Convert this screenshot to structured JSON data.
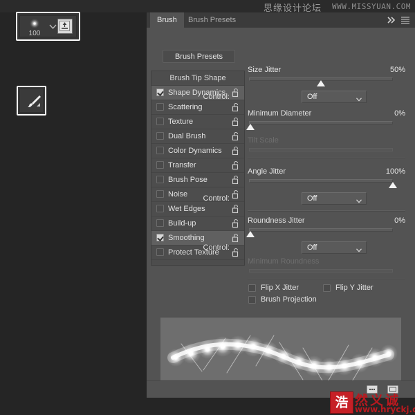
{
  "app": {
    "canvas_bg": "#252525",
    "panel_bg": "#535353",
    "accent_white": "#ffffff"
  },
  "watermark_top": {
    "text_cn": "思缘设计论坛",
    "url": "WWW.MISSYUAN.COM"
  },
  "watermark_bottom": {
    "logo_char": "浩",
    "text_cn": "然义诚",
    "url": "www.hryckj.cn",
    "color": "#b8191f"
  },
  "options_bar": {
    "brush_size": "100",
    "brush_preview_icon": "soft-round-glow-brush-icon",
    "dropdown_icon": "chevron-down-icon",
    "tablet_pressure_icon": "tablet-pressure-size-icon"
  },
  "toolbar": {
    "active_tool_icon": "paintbrush-tool-icon",
    "active_tool_name": "Brush Tool"
  },
  "panel": {
    "tabs": [
      {
        "label": "Brush",
        "active": true
      },
      {
        "label": "Brush Presets",
        "active": false
      }
    ],
    "header_icons": [
      {
        "name": "collapse-panel-icon",
        "glyph": "»"
      },
      {
        "name": "panel-menu-icon",
        "glyph": "≡"
      }
    ],
    "presets_button_label": "Brush Presets",
    "list_header": "Brush Tip Shape",
    "list_items": [
      {
        "label": "Shape Dynamics",
        "checked": true,
        "selected": true
      },
      {
        "label": "Scattering",
        "checked": false,
        "selected": false
      },
      {
        "label": "Texture",
        "checked": false,
        "selected": false
      },
      {
        "label": "Dual Brush",
        "checked": false,
        "selected": false
      },
      {
        "label": "Color Dynamics",
        "checked": false,
        "selected": false
      },
      {
        "label": "Transfer",
        "checked": false,
        "selected": false
      },
      {
        "label": "Brush Pose",
        "checked": false,
        "selected": false
      },
      {
        "label": "Noise",
        "checked": false,
        "selected": false
      },
      {
        "label": "Wet Edges",
        "checked": false,
        "selected": false
      },
      {
        "label": "Build-up",
        "checked": false,
        "selected": false
      },
      {
        "label": "Smoothing",
        "checked": true,
        "selected": true
      },
      {
        "label": "Protect Texture",
        "checked": false,
        "selected": false
      }
    ],
    "lock_icon": "unlocked-padlock-icon",
    "controls": {
      "size_jitter": {
        "label": "Size Jitter",
        "value": "50%",
        "pct": 50,
        "enabled": true
      },
      "size_control": {
        "label": "Control:",
        "value": "Off",
        "options": [
          "Off"
        ]
      },
      "minimum_diameter": {
        "label": "Minimum Diameter",
        "value": "0%",
        "pct": 0,
        "enabled": true
      },
      "tilt_scale": {
        "label": "Tilt Scale",
        "value": "",
        "pct": 0,
        "enabled": false
      },
      "angle_jitter": {
        "label": "Angle Jitter",
        "value": "100%",
        "pct": 100,
        "enabled": true
      },
      "angle_control": {
        "label": "Control:",
        "value": "Off",
        "options": [
          "Off"
        ]
      },
      "roundness_jitter": {
        "label": "Roundness Jitter",
        "value": "0%",
        "pct": 0,
        "enabled": true
      },
      "roundness_control": {
        "label": "Control:",
        "value": "Off",
        "options": [
          "Off"
        ]
      },
      "minimum_roundness": {
        "label": "Minimum Roundness",
        "value": "",
        "pct": 0,
        "enabled": false
      },
      "flip_x_jitter": {
        "label": "Flip X Jitter",
        "checked": false
      },
      "flip_y_jitter": {
        "label": "Flip Y Jitter",
        "checked": false
      },
      "brush_projection": {
        "label": "Brush Projection",
        "checked": false
      }
    },
    "preview": {
      "name": "brush-stroke-preview",
      "description": "sparkle star brush stroke wave",
      "bg": "#6e6e6e"
    },
    "footer_icons": [
      {
        "name": "toggle-brush-panel-icon"
      },
      {
        "name": "new-brush-preset-icon"
      }
    ]
  }
}
